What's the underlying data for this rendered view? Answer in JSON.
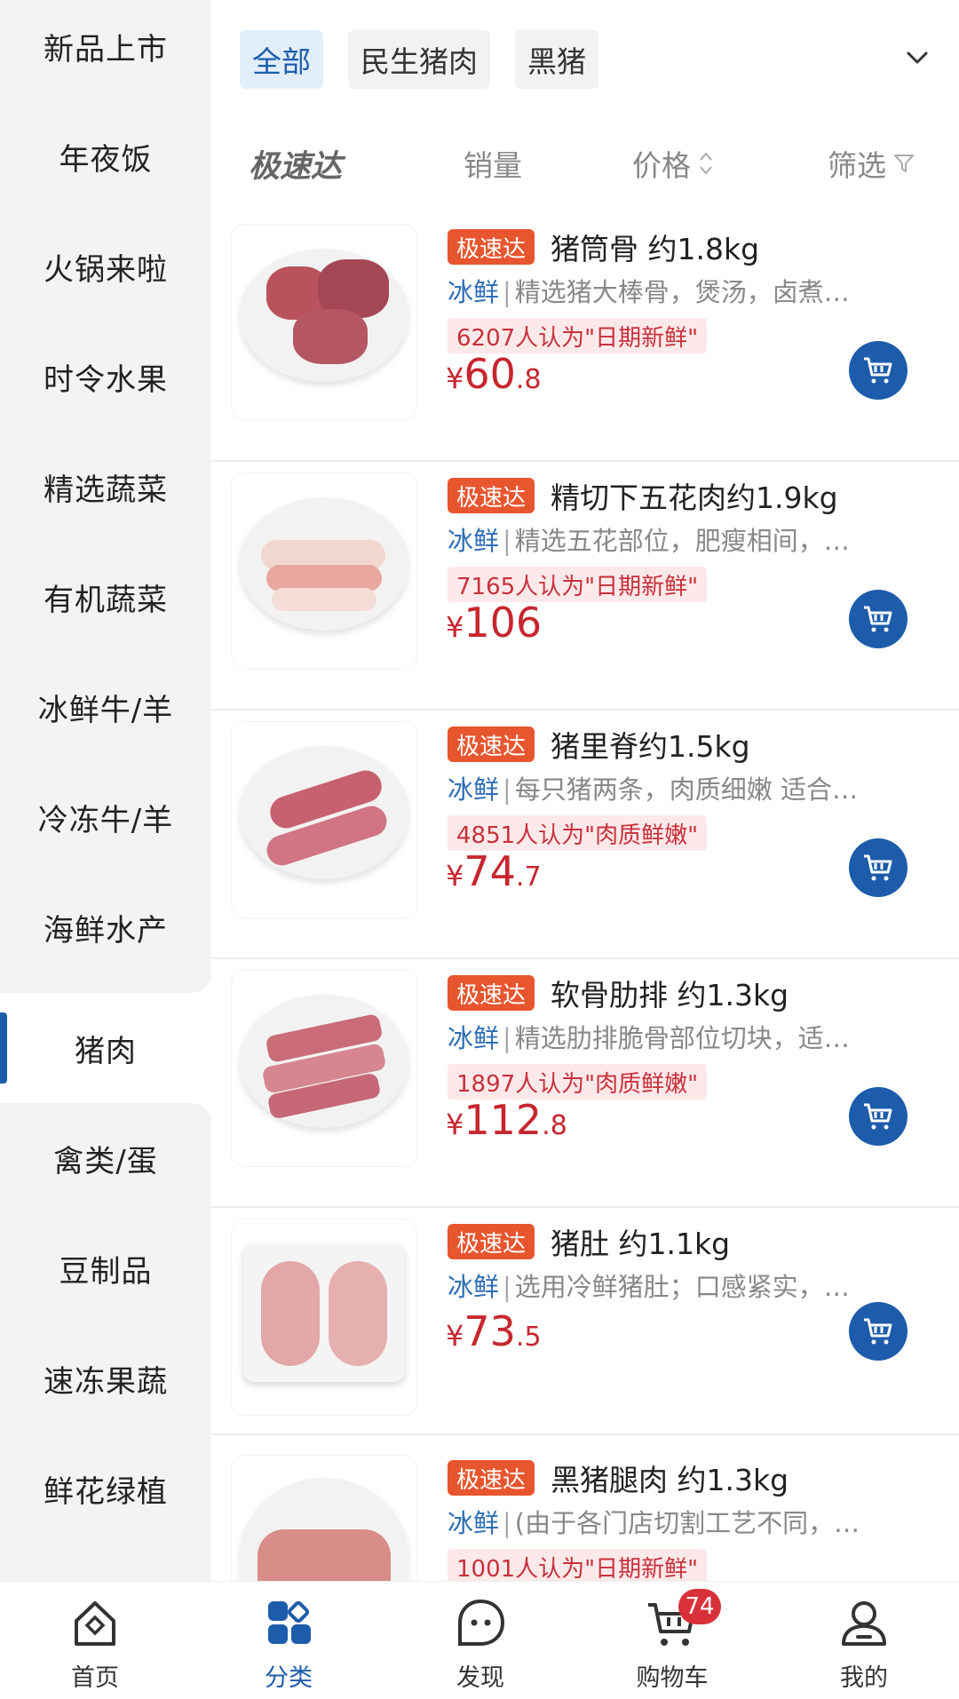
{
  "sidebar": {
    "items": [
      {
        "label": "新品上市"
      },
      {
        "label": "年夜饭"
      },
      {
        "label": "火锅来啦"
      },
      {
        "label": "时令水果"
      },
      {
        "label": "精选蔬菜"
      },
      {
        "label": "有机蔬菜"
      },
      {
        "label": "冰鲜牛/羊"
      },
      {
        "label": "冷冻牛/羊"
      },
      {
        "label": "海鲜水产"
      },
      {
        "label": "猪肉"
      },
      {
        "label": "禽类/蛋"
      },
      {
        "label": "豆制品"
      },
      {
        "label": "速冻果蔬"
      },
      {
        "label": "鲜花绿植"
      }
    ],
    "active": "猪肉"
  },
  "tabs": [
    {
      "label": "全部",
      "active": true
    },
    {
      "label": "民生猪肉",
      "active": false
    },
    {
      "label": "黑猪",
      "active": false
    }
  ],
  "sort": {
    "brand": "极速达",
    "sales": "销量",
    "price": "价格",
    "filter": "筛选"
  },
  "products": [
    {
      "badge": "极速达",
      "title": "猪筒骨 约1.8kg",
      "tag": "冰鲜",
      "desc": "精选猪大棒骨，煲汤，卤煮…",
      "fresh": "6207人认为\"日期新鲜\"",
      "currency": "¥",
      "price_int": "60",
      "price_dec": ".8"
    },
    {
      "badge": "极速达",
      "title": "精切下五花肉约1.9kg",
      "tag": "冰鲜",
      "desc": "精选五花部位，肥瘦相间，…",
      "fresh": "7165人认为\"日期新鲜\"",
      "currency": "¥",
      "price_int": "106",
      "price_dec": ""
    },
    {
      "badge": "极速达",
      "title": "猪里脊约1.5kg",
      "tag": "冰鲜",
      "desc": "每只猪两条，肉质细嫩  适合…",
      "fresh": "4851人认为\"肉质鲜嫩\"",
      "currency": "¥",
      "price_int": "74",
      "price_dec": ".7"
    },
    {
      "badge": "极速达",
      "title": "软骨肋排 约1.3kg",
      "tag": "冰鲜",
      "desc": "精选肋排脆骨部位切块，适…",
      "fresh": "1897人认为\"肉质鲜嫩\"",
      "currency": "¥",
      "price_int": "112",
      "price_dec": ".8"
    },
    {
      "badge": "极速达",
      "title": "猪肚 约1.1kg",
      "tag": "冰鲜",
      "desc": "选用冷鲜猪肚；口感紧实，…",
      "fresh": "",
      "currency": "¥",
      "price_int": "73",
      "price_dec": ".5"
    },
    {
      "badge": "极速达",
      "title": "黑猪腿肉 约1.3kg",
      "tag": "冰鲜",
      "desc": "(由于各门店切割工艺不同，…",
      "fresh": "1001人认为\"日期新鲜\"",
      "currency": "¥",
      "price_int": "",
      "price_dec": ""
    }
  ],
  "bottom_nav": [
    {
      "label": "首页",
      "icon": "home-icon"
    },
    {
      "label": "分类",
      "icon": "category-icon",
      "active": true
    },
    {
      "label": "发现",
      "icon": "discover-icon"
    },
    {
      "label": "购物车",
      "icon": "cart-icon",
      "badge": "74"
    },
    {
      "label": "我的",
      "icon": "profile-icon"
    }
  ],
  "colors": {
    "accent": "#1c5cab",
    "price": "#c7262e",
    "badge": "#e8562f"
  }
}
